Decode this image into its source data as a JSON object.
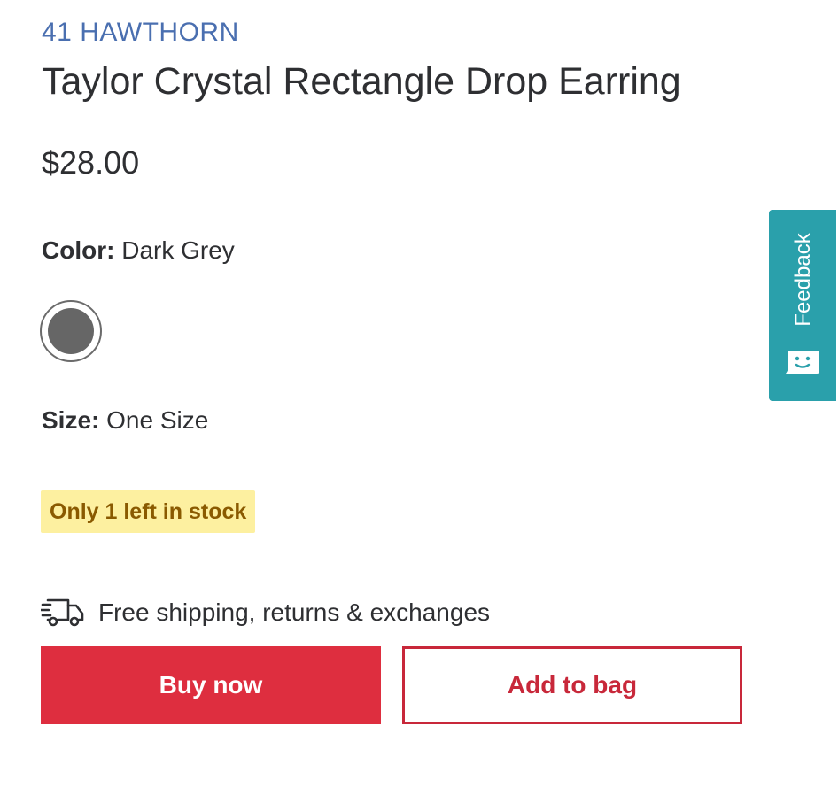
{
  "product": {
    "brand": "41 HAWTHORN",
    "title": "Taylor Crystal Rectangle Drop Earring",
    "price": "$28.00",
    "color": {
      "label": "Color:",
      "value": "Dark Grey",
      "swatch_hex": "#666666"
    },
    "size": {
      "label": "Size:",
      "value": "One Size"
    },
    "stock_message": "Only 1 left in stock"
  },
  "shipping": {
    "icon": "truck-icon",
    "text": "Free shipping, returns & exchanges"
  },
  "actions": {
    "buy_now_label": "Buy now",
    "add_to_bag_label": "Add to bag"
  },
  "feedback": {
    "label": "Feedback",
    "icon": "chat-smiley-icon"
  },
  "colors": {
    "brand_link": "#4a6fb0",
    "primary_red": "#de2e3f",
    "feedback_teal": "#2aa0ab",
    "stock_badge_bg": "#fdf0a0"
  }
}
